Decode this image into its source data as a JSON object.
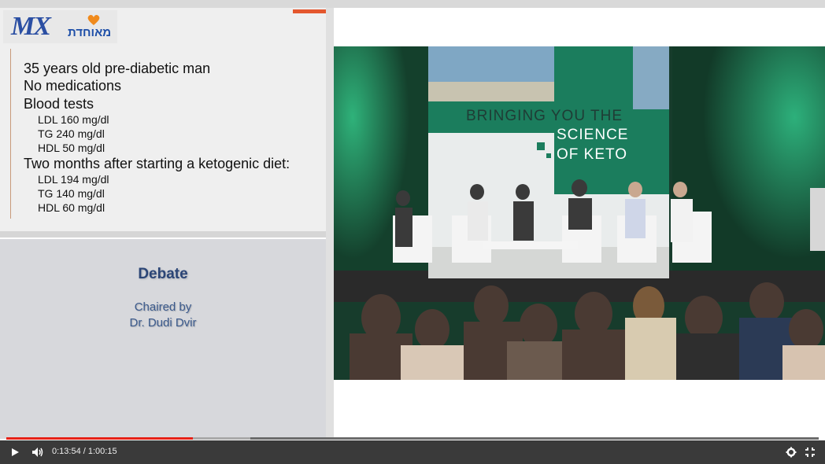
{
  "slide": {
    "logo_text": "MX",
    "logo_hebrew": "מאוחדת",
    "lines": [
      {
        "text": "35 years old pre-diabetic man",
        "level": 1
      },
      {
        "text": "No medications",
        "level": 1
      },
      {
        "text": "Blood tests",
        "level": 1
      },
      {
        "text": "LDL 160 mg/dl",
        "level": 2
      },
      {
        "text": "TG 240 mg/dl",
        "level": 2
      },
      {
        "text": "HDL 50 mg/dl",
        "level": 2
      },
      {
        "text": "Two months after starting a ketogenic diet:",
        "level": 1
      },
      {
        "text": "LDL 194 mg/dl",
        "level": 2
      },
      {
        "text": "TG 140 mg/dl",
        "level": 2
      },
      {
        "text": "HDL 60 mg/dl",
        "level": 2
      }
    ]
  },
  "debate": {
    "title": "Debate",
    "chaired_by": "Chaired by",
    "chair_name": "Dr. Dudi Dvir"
  },
  "video": {
    "banner_line1": "BRINGING YOU THE",
    "banner_line2": "SCIENCE",
    "banner_line3": "OF KETO"
  },
  "player": {
    "time_display": "0:13:54 / 1:00:15",
    "progress_played": 0.23,
    "progress_buffered": 0.3,
    "icons": [
      "play-icon",
      "volume-icon",
      "gear-icon",
      "fullscreen-exit-icon"
    ],
    "accent_color": "#e62117"
  }
}
